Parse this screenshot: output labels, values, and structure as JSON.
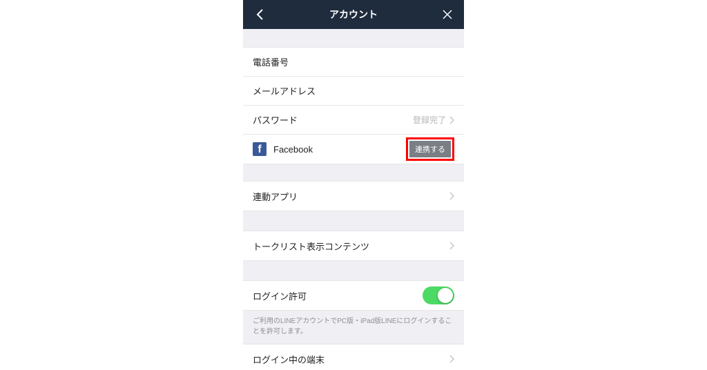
{
  "header": {
    "title": "アカウント"
  },
  "rows": {
    "phone": "電話番号",
    "email": "メールアドレス",
    "password": "パスワード",
    "password_value": "登録完了",
    "facebook": "Facebook",
    "facebook_button": "連携する",
    "linked_apps": "連動アプリ",
    "talk_list": "トークリスト表示コンテンツ",
    "login_permission": "ログイン許可",
    "login_note": "ご利用のLINEアカウントでPC版・iPad版LINEにログインすることを許可します。",
    "logged_in_devices": "ログイン中の端末"
  }
}
